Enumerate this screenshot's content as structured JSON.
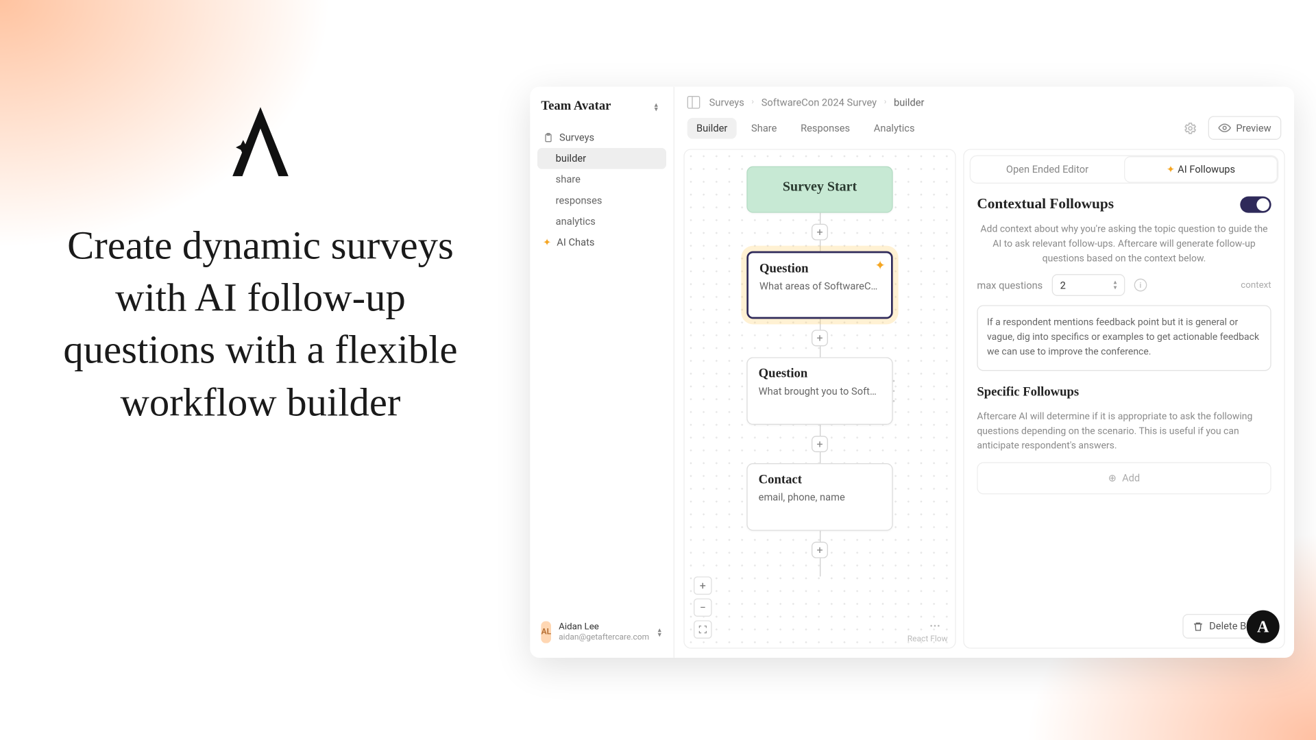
{
  "marketing": {
    "headline": "Create dynamic surveys with AI follow-up questions with a flexible workflow builder"
  },
  "sidebar": {
    "team": "Team Avatar",
    "items": [
      {
        "label": "Surveys",
        "icon": "clipboard"
      },
      {
        "label": "builder",
        "child": true,
        "active": true
      },
      {
        "label": "share",
        "child": true
      },
      {
        "label": "responses",
        "child": true
      },
      {
        "label": "analytics",
        "child": true
      },
      {
        "label": "AI Chats",
        "icon": "sparkle"
      }
    ],
    "user": {
      "initials": "AL",
      "name": "Aidan Lee",
      "email": "aidan@getaftercare.com"
    }
  },
  "breadcrumbs": [
    "Surveys",
    "SoftwareCon 2024 Survey",
    "builder"
  ],
  "tabs": [
    "Builder",
    "Share",
    "Responses",
    "Analytics"
  ],
  "active_tab": "Builder",
  "preview_label": "Preview",
  "flow": {
    "start": "Survey Start",
    "nodes": [
      {
        "title": "Question",
        "body": "What areas of SoftwareCo…",
        "selected": true,
        "spark": true
      },
      {
        "title": "Question",
        "body": "What brought you to Softw…"
      },
      {
        "title": "Contact",
        "body": "email, phone, name"
      }
    ],
    "attrib": "React Flow"
  },
  "side_panel": {
    "tabs": [
      "Open Ended Editor",
      "AI Followups"
    ],
    "active": "AI Followups",
    "contextual": {
      "title": "Contextual Followups",
      "toggle": true,
      "desc": "Add context about why you're asking the topic question to guide the AI to ask relevant follow-ups. Aftercare will generate follow-up questions based on the context below.",
      "max_label": "max questions",
      "max_value": "2",
      "context_label": "context",
      "context_text": "If a respondent mentions feedback point but it is general or vague, dig into specifics or examples to get actionable feedback we can use to improve the conference."
    },
    "specific": {
      "title": "Specific Followups",
      "desc": "Aftercare AI will determine if it is appropriate to ask the following questions depending on the scenario. This is useful if you can anticipate respondent's answers.",
      "add_label": "Add"
    },
    "delete_label": "Delete Block"
  }
}
